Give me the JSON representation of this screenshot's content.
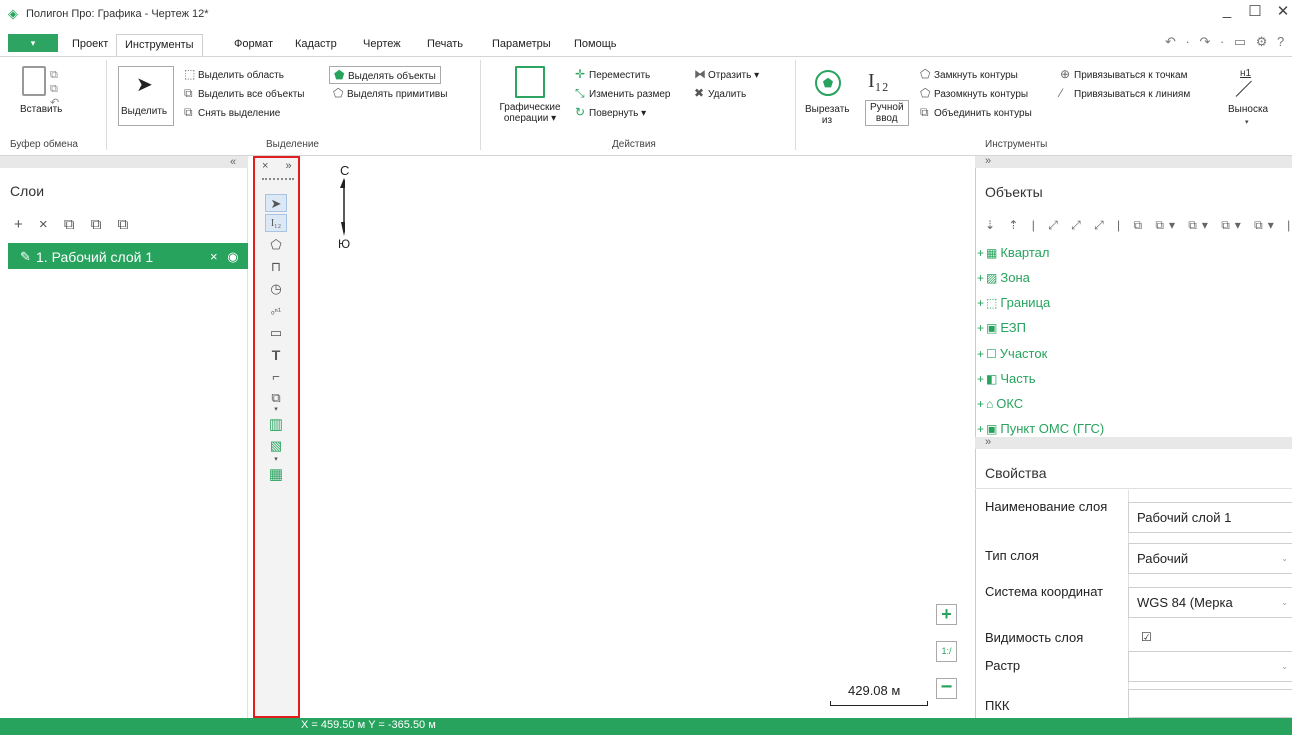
{
  "window": {
    "title": "Полигон Про: Графика - Чертеж 12*",
    "minimize": "_",
    "maximize": "☐",
    "close": "✕"
  },
  "menu": {
    "file": "▾",
    "tabs": [
      "Проект",
      "Инструменты",
      "Формат",
      "Кадастр",
      "Чертеж",
      "Печать",
      "Параметры",
      "Помощь"
    ],
    "active_tab": "Инструменты",
    "quick_icons": "↶ · ↷ · ▭ ⚙ ?"
  },
  "ribbon": {
    "clipboard": {
      "paste": "Вставить",
      "label": "Буфер обмена"
    },
    "selection": {
      "select": "Выделить",
      "select_area": "Выделить область",
      "select_all": "Выделить все объекты",
      "deselect": "Снять выделение",
      "select_objects": "Выделять объекты",
      "select_primitives": "Выделять примитивы",
      "label": "Выделение"
    },
    "actions": {
      "graphic_ops_1": "Графические",
      "graphic_ops_2": "операции ▾",
      "move": "Переместить",
      "resize": "Изменить размер",
      "rotate": "Повернуть ▾",
      "mirror": "Отразить ▾",
      "delete": "Удалить",
      "label": "Действия"
    },
    "tools": {
      "cut_1": "Вырезать",
      "cut_2": "из",
      "manual_1": "Ручной",
      "manual_2": "ввод",
      "close_contours": "Замкнуть контуры",
      "open_contours": "Разомкнуть контуры",
      "merge_contours": "Объединить контуры",
      "snap_points": "Привязываться к точкам",
      "snap_lines": "Привязываться к линиям",
      "callout": "Выноска",
      "callout_caret": "▾",
      "label": "Инструменты"
    }
  },
  "layers_panel": {
    "collapse": "«",
    "title": "Слои",
    "tools": "+ × ⧉ ⧉ ⧉",
    "layer": {
      "name": "1. Рабочий слой 1",
      "actions": "× ◉ ·"
    }
  },
  "toolbox": {
    "header": "× »"
  },
  "canvas": {
    "north": "С",
    "south": "Ю",
    "scale": "429.08 м",
    "zoom_in": "+",
    "zoom_fit": "1:/",
    "zoom_out": "−"
  },
  "objects_panel": {
    "collapse": "»",
    "title": "Объекты",
    "tools": "⇣ ⇡ | ⤢ ⤢ ⤢ | ⧉ ⧉▾ ⧉▾ ⧉▾ ⧉▾ | ✕",
    "items": [
      {
        "label": "Квартал",
        "icon": "▦"
      },
      {
        "label": "Зона",
        "icon": "▨"
      },
      {
        "label": "Граница",
        "icon": "⬚"
      },
      {
        "label": "ЕЗП",
        "icon": "▣"
      },
      {
        "label": "Участок",
        "icon": "☐"
      },
      {
        "label": "Часть",
        "icon": "◧"
      },
      {
        "label": "ОКС",
        "icon": "⌂"
      },
      {
        "label": "Пункт ОМС (ГГС)",
        "icon": "▣"
      }
    ]
  },
  "properties_panel": {
    "collapse": "»",
    "title": "Свойства",
    "rows": [
      {
        "label": "Наименование слоя",
        "value": "Рабочий слой 1"
      },
      {
        "label": "Тип слоя",
        "value": "Рабочий"
      },
      {
        "label": "Система координат",
        "value": "WGS 84 (Мерка"
      },
      {
        "label": "Видимость слоя",
        "value": "☑"
      },
      {
        "label": "Растр",
        "value": ""
      },
      {
        "label": "ПКК",
        "value": ""
      }
    ]
  },
  "status": {
    "coords": "X = 459.50 м   Y = -365.50 м"
  },
  "colors": {
    "accent": "#27a35e",
    "highlight_border": "#e01e1e"
  }
}
